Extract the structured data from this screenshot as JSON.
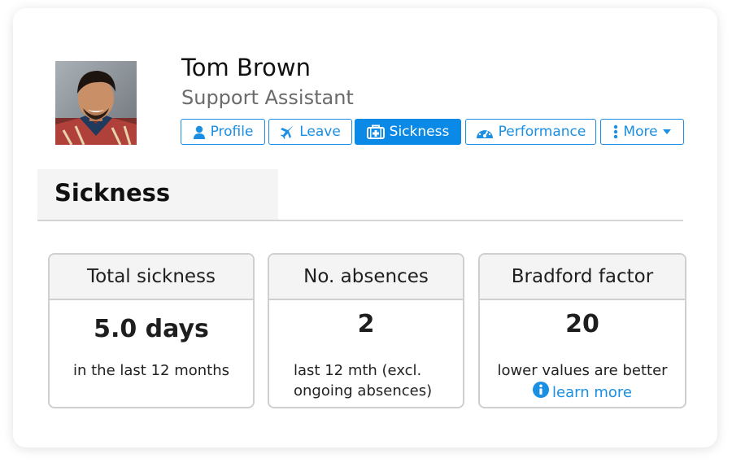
{
  "profile": {
    "name": "Tom Brown",
    "role": "Support Assistant"
  },
  "tabs": [
    {
      "label": "Profile",
      "icon": "user-icon"
    },
    {
      "label": "Leave",
      "icon": "plane-icon"
    },
    {
      "label": "Sickness",
      "icon": "medical-kit-icon",
      "active": true
    },
    {
      "label": "Performance",
      "icon": "gauge-icon"
    },
    {
      "label": "More",
      "icon": "vertical-ellipsis-icon"
    }
  ],
  "section": {
    "title": "Sickness"
  },
  "stats": [
    {
      "title": "Total sickness",
      "value": "5.0 days",
      "note": "in the last 12 months"
    },
    {
      "title": "No. absences",
      "value": "2",
      "note": "last 12 mth (excl. ongoing absences)"
    },
    {
      "title": "Bradford factor",
      "value": "20",
      "note": "lower values are better",
      "link": "learn more"
    }
  ],
  "colors": {
    "accent": "#1a8fe3",
    "active_tab": "#0a8ae6",
    "panel_header": "#f4f4f5",
    "border": "#cfcfd1"
  }
}
